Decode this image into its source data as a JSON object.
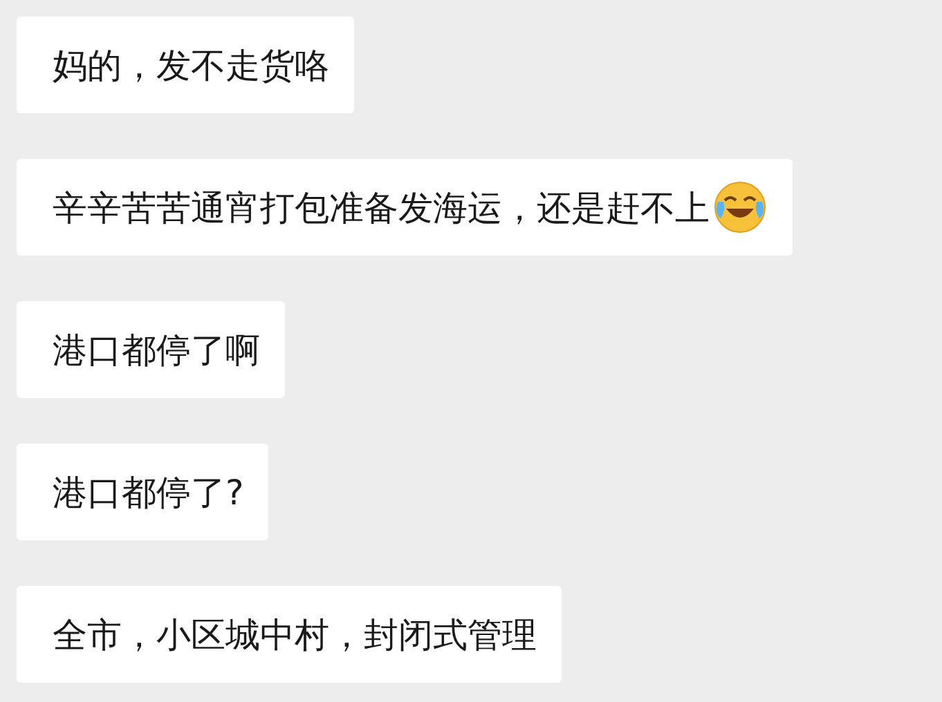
{
  "messages": [
    {
      "text": "妈的，发不走货咯",
      "has_emoji": false
    },
    {
      "text": "辛辛苦苦通宵打包准备发海运，还是赶不上",
      "has_emoji": true
    },
    {
      "text": "港口都停了啊",
      "has_emoji": false
    },
    {
      "text": "港口都停了?",
      "has_emoji": false
    },
    {
      "text": "全市，小区城中村，封闭式管理",
      "has_emoji": false
    }
  ]
}
